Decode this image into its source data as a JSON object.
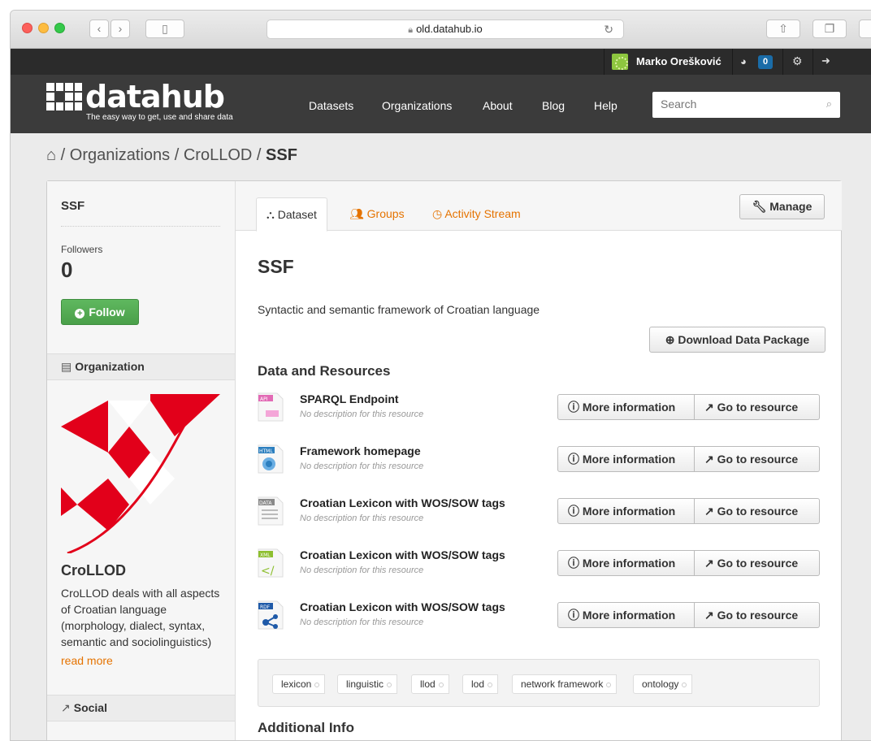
{
  "browser": {
    "url": "old.datahub.io"
  },
  "account": {
    "user_name": "Marko Orešković",
    "dashboard_count": "0"
  },
  "masthead": {
    "logo_text": "datahub",
    "tagline": "The easy way to get, use and share data",
    "nav": [
      "Datasets",
      "Organizations",
      "About",
      "Blog",
      "Help"
    ],
    "search_placeholder": "Search"
  },
  "breadcrumb": {
    "items": [
      "Organizations",
      "CroLLOD"
    ],
    "current": "SSF"
  },
  "sidebar": {
    "dataset_title": "SSF",
    "followers_label": "Followers",
    "followers_count": "0",
    "follow_label": "Follow",
    "organization_heading": "Organization",
    "org_name": "CroLLOD",
    "org_description": "CroLLOD deals with all aspects of Croatian language (morphology, dialect, syntax, semantic and sociolinguistics)",
    "read_more": "read more",
    "social_heading": "Social",
    "colors": {
      "logo_red": "#e2001a"
    }
  },
  "tabs": {
    "dataset": "Dataset",
    "groups": "Groups",
    "activity": "Activity Stream",
    "manage": "Manage"
  },
  "dataset": {
    "title": "SSF",
    "notes": "Syntactic and semantic framework of Croatian language",
    "download_label": "Download Data Package",
    "resources_heading": "Data and Resources",
    "more_info_label": "More information",
    "go_label": "Go to resource",
    "resources": [
      {
        "name": "SPARQL Endpoint",
        "desc": "No description for this resource",
        "format": "API",
        "format_color": "#e26ab5"
      },
      {
        "name": "Framework homepage",
        "desc": "No description for this resource",
        "format": "HTML",
        "format_color": "#2c7fbf"
      },
      {
        "name": "Croatian Lexicon with WOS/SOW tags",
        "desc": "No description for this resource",
        "format": "DATA",
        "format_color": "#8a8a8a"
      },
      {
        "name": "Croatian Lexicon with WOS/SOW tags",
        "desc": "No description for this resource",
        "format": "XML",
        "format_color": "#8dbf2f"
      },
      {
        "name": "Croatian Lexicon with WOS/SOW tags",
        "desc": "No description for this resource",
        "format": "RDF",
        "format_color": "#1f5aa8"
      }
    ],
    "tags": [
      "lexicon",
      "linguistic",
      "llod",
      "lod",
      "network framework",
      "ontology"
    ],
    "additional_info_heading": "Additional Info"
  }
}
